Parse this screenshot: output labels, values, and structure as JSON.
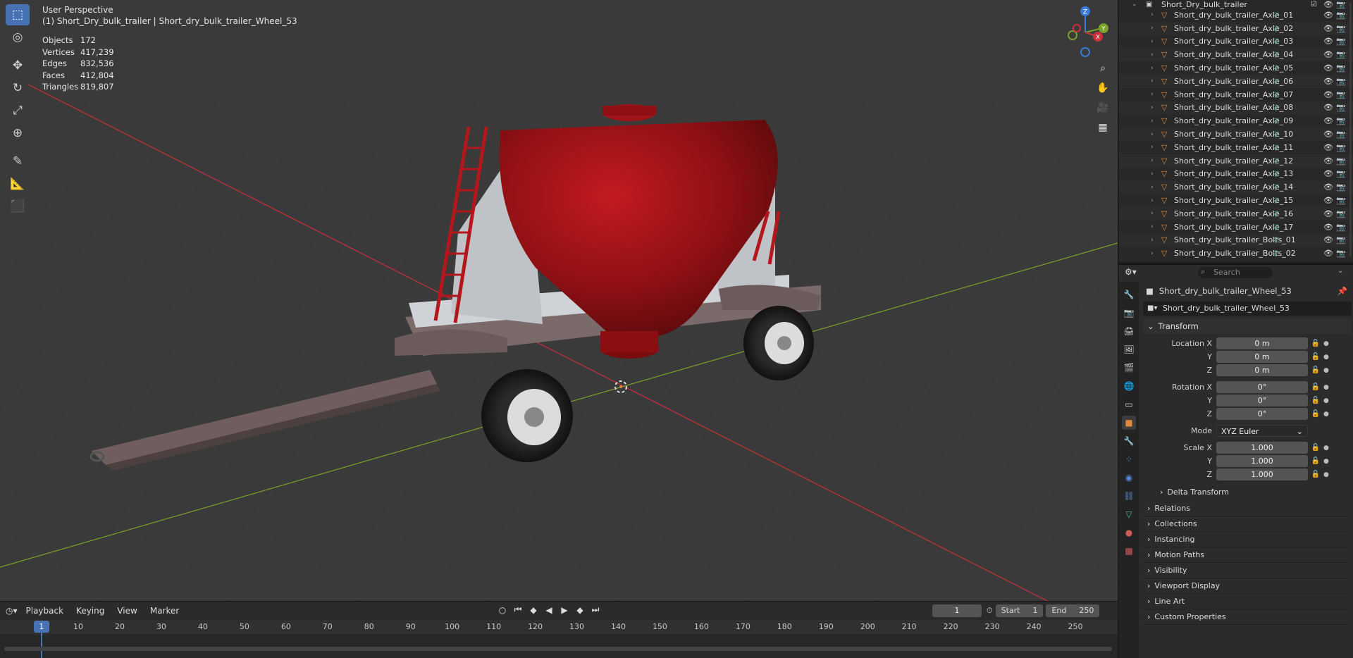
{
  "viewport": {
    "perspective": "User Perspective",
    "context": "(1) Short_Dry_bulk_trailer | Short_dry_bulk_trailer_Wheel_53",
    "stats": [
      {
        "label": "Objects",
        "value": "172"
      },
      {
        "label": "Vertices",
        "value": "417,239"
      },
      {
        "label": "Edges",
        "value": "832,536"
      },
      {
        "label": "Faces",
        "value": "412,804"
      },
      {
        "label": "Triangles",
        "value": "819,807"
      }
    ],
    "gizmo": {
      "z": "Z",
      "y": "Y",
      "x": "X"
    }
  },
  "timeline": {
    "menus": [
      "Playback",
      "Keying",
      "View",
      "Marker"
    ],
    "current_frame": "1",
    "start_label": "Start",
    "start": "1",
    "end_label": "End",
    "end": "250",
    "ruler": [
      "1",
      "10",
      "20",
      "30",
      "40",
      "50",
      "60",
      "70",
      "80",
      "90",
      "100",
      "110",
      "120",
      "130",
      "140",
      "150",
      "160",
      "170",
      "180",
      "190",
      "200",
      "210",
      "220",
      "230",
      "240",
      "250"
    ]
  },
  "outliner": {
    "root": "Short_Dry_bulk_trailer",
    "items": [
      "Short_dry_bulk_trailer_Axle_01",
      "Short_dry_bulk_trailer_Axle_02",
      "Short_dry_bulk_trailer_Axle_03",
      "Short_dry_bulk_trailer_Axle_04",
      "Short_dry_bulk_trailer_Axle_05",
      "Short_dry_bulk_trailer_Axle_06",
      "Short_dry_bulk_trailer_Axle_07",
      "Short_dry_bulk_trailer_Axle_08",
      "Short_dry_bulk_trailer_Axle_09",
      "Short_dry_bulk_trailer_Axle_10",
      "Short_dry_bulk_trailer_Axle_11",
      "Short_dry_bulk_trailer_Axle_12",
      "Short_dry_bulk_trailer_Axle_13",
      "Short_dry_bulk_trailer_Axle_14",
      "Short_dry_bulk_trailer_Axle_15",
      "Short_dry_bulk_trailer_Axle_16",
      "Short_dry_bulk_trailer_Axle_17",
      "Short_dry_bulk_trailer_Bolts_01",
      "Short_dry_bulk_trailer_Bolts_02"
    ]
  },
  "properties": {
    "search_placeholder": "Search",
    "object_title": "Short_dry_bulk_trailer_Wheel_53",
    "object_name": "Short_dry_bulk_trailer_Wheel_53",
    "transform": {
      "header": "Transform",
      "location": [
        {
          "label": "Location X",
          "value": "0 m"
        },
        {
          "label": "Y",
          "value": "0 m"
        },
        {
          "label": "Z",
          "value": "0 m"
        }
      ],
      "rotation": [
        {
          "label": "Rotation X",
          "value": "0°"
        },
        {
          "label": "Y",
          "value": "0°"
        },
        {
          "label": "Z",
          "value": "0°"
        }
      ],
      "mode_label": "Mode",
      "mode_value": "XYZ Euler",
      "scale": [
        {
          "label": "Scale X",
          "value": "1.000"
        },
        {
          "label": "Y",
          "value": "1.000"
        },
        {
          "label": "Z",
          "value": "1.000"
        }
      ],
      "delta": "Delta Transform"
    },
    "panels": [
      "Relations",
      "Collections",
      "Instancing",
      "Motion Paths",
      "Visibility",
      "Viewport Display",
      "Line Art",
      "Custom Properties"
    ]
  },
  "colors": {
    "accent": "#4772b3",
    "tank": "#a01418",
    "x_axis": "#c9303a",
    "y_axis": "#7aa12a",
    "z_axis": "#3a7bd5"
  }
}
